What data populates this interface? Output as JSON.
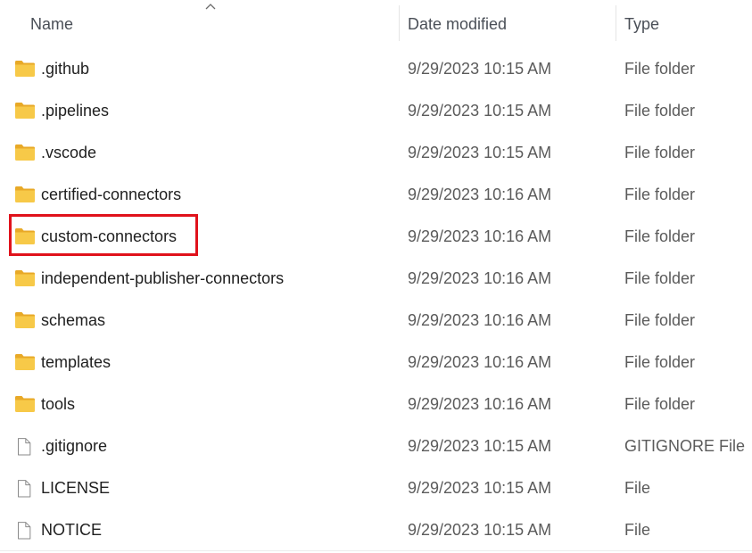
{
  "columns": {
    "name": "Name",
    "date": "Date modified",
    "type": "Type"
  },
  "sort": {
    "column": "name",
    "direction": "ascending",
    "icon": "chevron-up-icon"
  },
  "files": [
    {
      "name": ".github",
      "date": "9/29/2023 10:15 AM",
      "type": "File folder",
      "icon": "folder-icon"
    },
    {
      "name": ".pipelines",
      "date": "9/29/2023 10:15 AM",
      "type": "File folder",
      "icon": "folder-icon"
    },
    {
      "name": ".vscode",
      "date": "9/29/2023 10:15 AM",
      "type": "File folder",
      "icon": "folder-icon"
    },
    {
      "name": "certified-connectors",
      "date": "9/29/2023 10:16 AM",
      "type": "File folder",
      "icon": "folder-icon"
    },
    {
      "name": "custom-connectors",
      "date": "9/29/2023 10:16 AM",
      "type": "File folder",
      "icon": "folder-icon",
      "highlighted": true
    },
    {
      "name": "independent-publisher-connectors",
      "date": "9/29/2023 10:16 AM",
      "type": "File folder",
      "icon": "folder-icon"
    },
    {
      "name": "schemas",
      "date": "9/29/2023 10:16 AM",
      "type": "File folder",
      "icon": "folder-icon"
    },
    {
      "name": "templates",
      "date": "9/29/2023 10:16 AM",
      "type": "File folder",
      "icon": "folder-icon"
    },
    {
      "name": "tools",
      "date": "9/29/2023 10:16 AM",
      "type": "File folder",
      "icon": "folder-icon"
    },
    {
      "name": ".gitignore",
      "date": "9/29/2023 10:15 AM",
      "type": "GITIGNORE File",
      "icon": "file-icon"
    },
    {
      "name": "LICENSE",
      "date": "9/29/2023 10:15 AM",
      "type": "File",
      "icon": "file-icon"
    },
    {
      "name": "NOTICE",
      "date": "9/29/2023 10:15 AM",
      "type": "File",
      "icon": "file-icon"
    }
  ],
  "colors": {
    "highlight_border": "#e0121b",
    "folder_body": "#f7c948",
    "folder_tab": "#e8a927"
  }
}
